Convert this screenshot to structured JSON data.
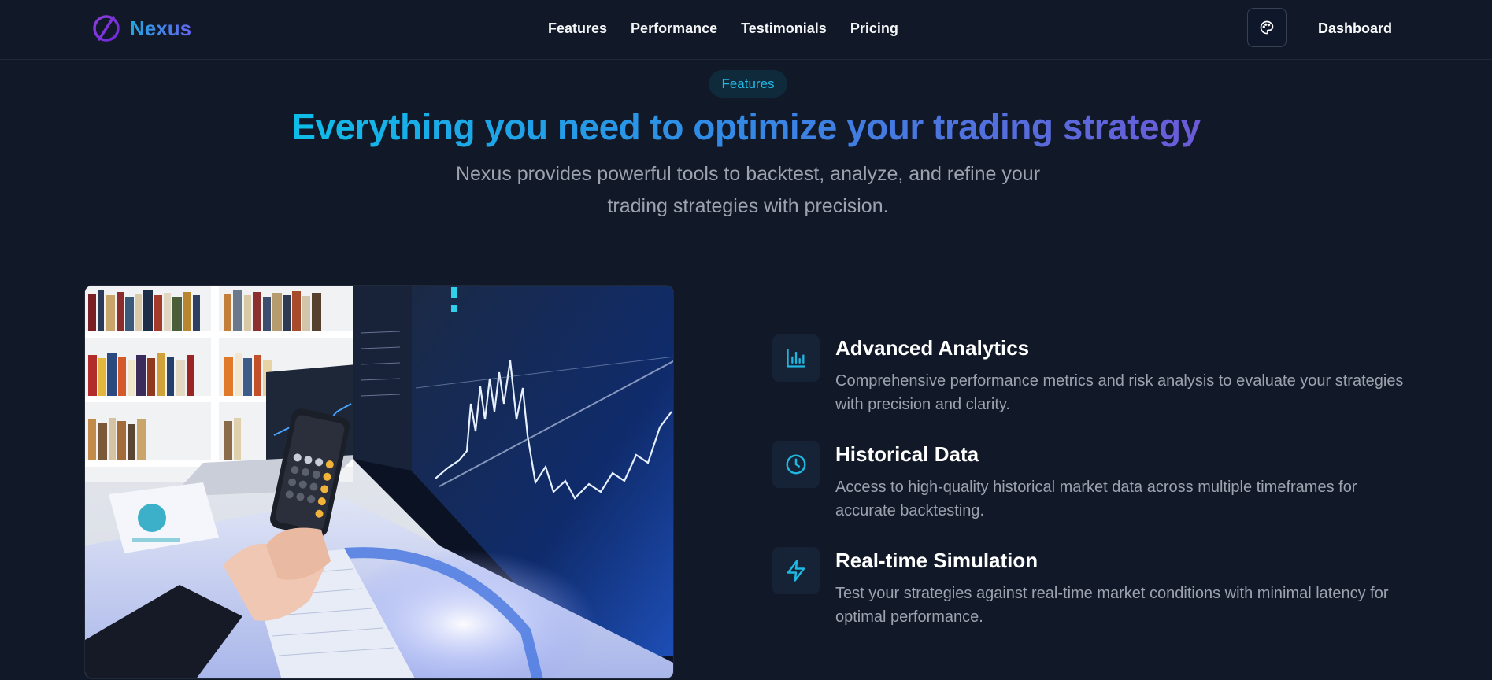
{
  "brand": {
    "name": "Nexus"
  },
  "nav": {
    "links": [
      "Features",
      "Performance",
      "Testimonials",
      "Pricing"
    ],
    "dashboard_label": "Dashboard",
    "theme_toggle_icon": "palette-icon"
  },
  "hero": {
    "badge": "Features",
    "title": "Everything you need to optimize your trading strategy",
    "subtitle": "Nexus provides powerful tools to backtest, analyze, and refine your trading strategies with precision."
  },
  "features": [
    {
      "icon": "bar-chart-icon",
      "title": "Advanced Analytics",
      "description": "Comprehensive performance metrics and risk analysis to evaluate your strategies with precision and clarity."
    },
    {
      "icon": "clock-icon",
      "title": "Historical Data",
      "description": "Access to high-quality historical market data across multiple timeframes for accurate backtesting."
    },
    {
      "icon": "lightning-icon",
      "title": "Real-time Simulation",
      "description": "Test your strategies against real-time market conditions with minimal latency for optimal performance."
    }
  ],
  "colors": {
    "background": "#111827",
    "accent": "#0ebde8",
    "accent_secondary": "#6b5bd8",
    "muted_text": "#9ca3af"
  }
}
